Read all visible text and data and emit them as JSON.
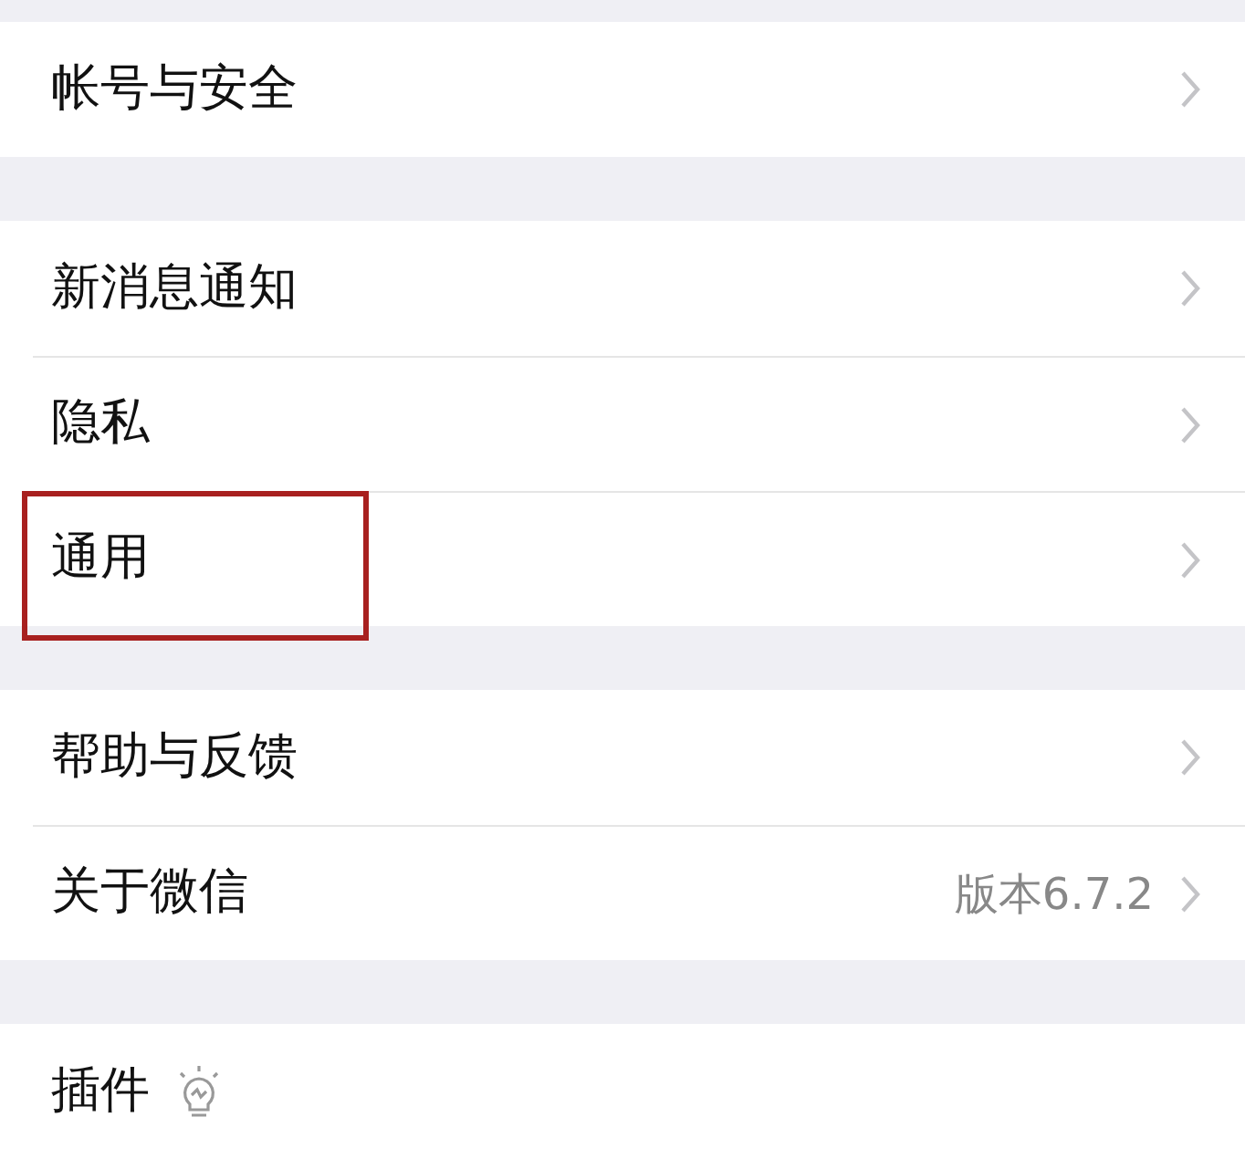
{
  "groups": [
    {
      "items": [
        {
          "label": "帐号与安全",
          "chevron": true,
          "highlighted": false
        }
      ]
    },
    {
      "items": [
        {
          "label": "新消息通知",
          "chevron": true,
          "highlighted": false
        },
        {
          "label": "隐私",
          "chevron": true,
          "highlighted": false
        },
        {
          "label": "通用",
          "chevron": true,
          "highlighted": true
        }
      ]
    },
    {
      "items": [
        {
          "label": "帮助与反馈",
          "chevron": true,
          "highlighted": false
        },
        {
          "label": "关于微信",
          "value": "版本6.7.2",
          "chevron": true,
          "highlighted": false
        }
      ]
    },
    {
      "items": [
        {
          "label": "插件",
          "kind": "bulb",
          "chevron": false,
          "highlighted": false
        }
      ]
    }
  ]
}
